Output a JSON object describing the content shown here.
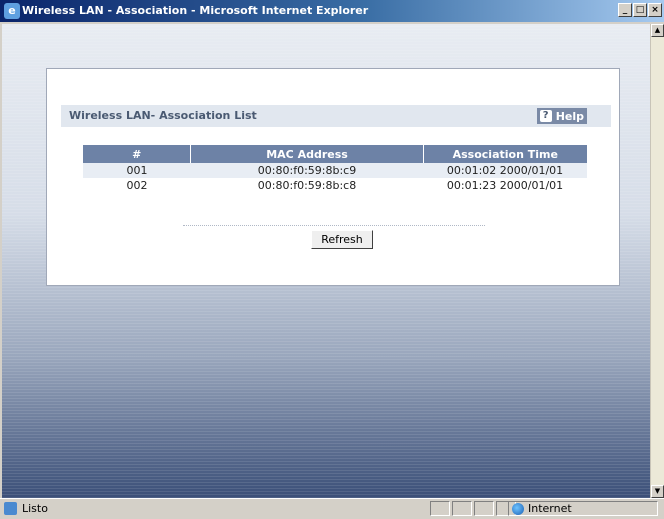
{
  "window": {
    "title": "Wireless LAN - Association - Microsoft Internet Explorer",
    "controls": {
      "minimize": "_",
      "maximize": "□",
      "close": "×"
    }
  },
  "panel": {
    "title": "Wireless LAN- Association List",
    "help_label": "Help",
    "help_icon_glyph": "?"
  },
  "table": {
    "headers": [
      "#",
      "MAC Address",
      "Association Time"
    ],
    "rows": [
      [
        "001",
        "00:80:f0:59:8b:c9",
        "00:01:02 2000/01/01"
      ],
      [
        "002",
        "00:80:f0:59:8b:c8",
        "00:01:23 2000/01/01"
      ]
    ]
  },
  "refresh_label": "Refresh",
  "statusbar": {
    "status": "Listo",
    "zone": "Internet"
  },
  "scrollbar": {
    "up_glyph": "▲",
    "down_glyph": "▼"
  },
  "colors": {
    "titlebar": "#0a246a",
    "table_header": "#6d82a6",
    "panel_head": "#e1e7ef"
  }
}
